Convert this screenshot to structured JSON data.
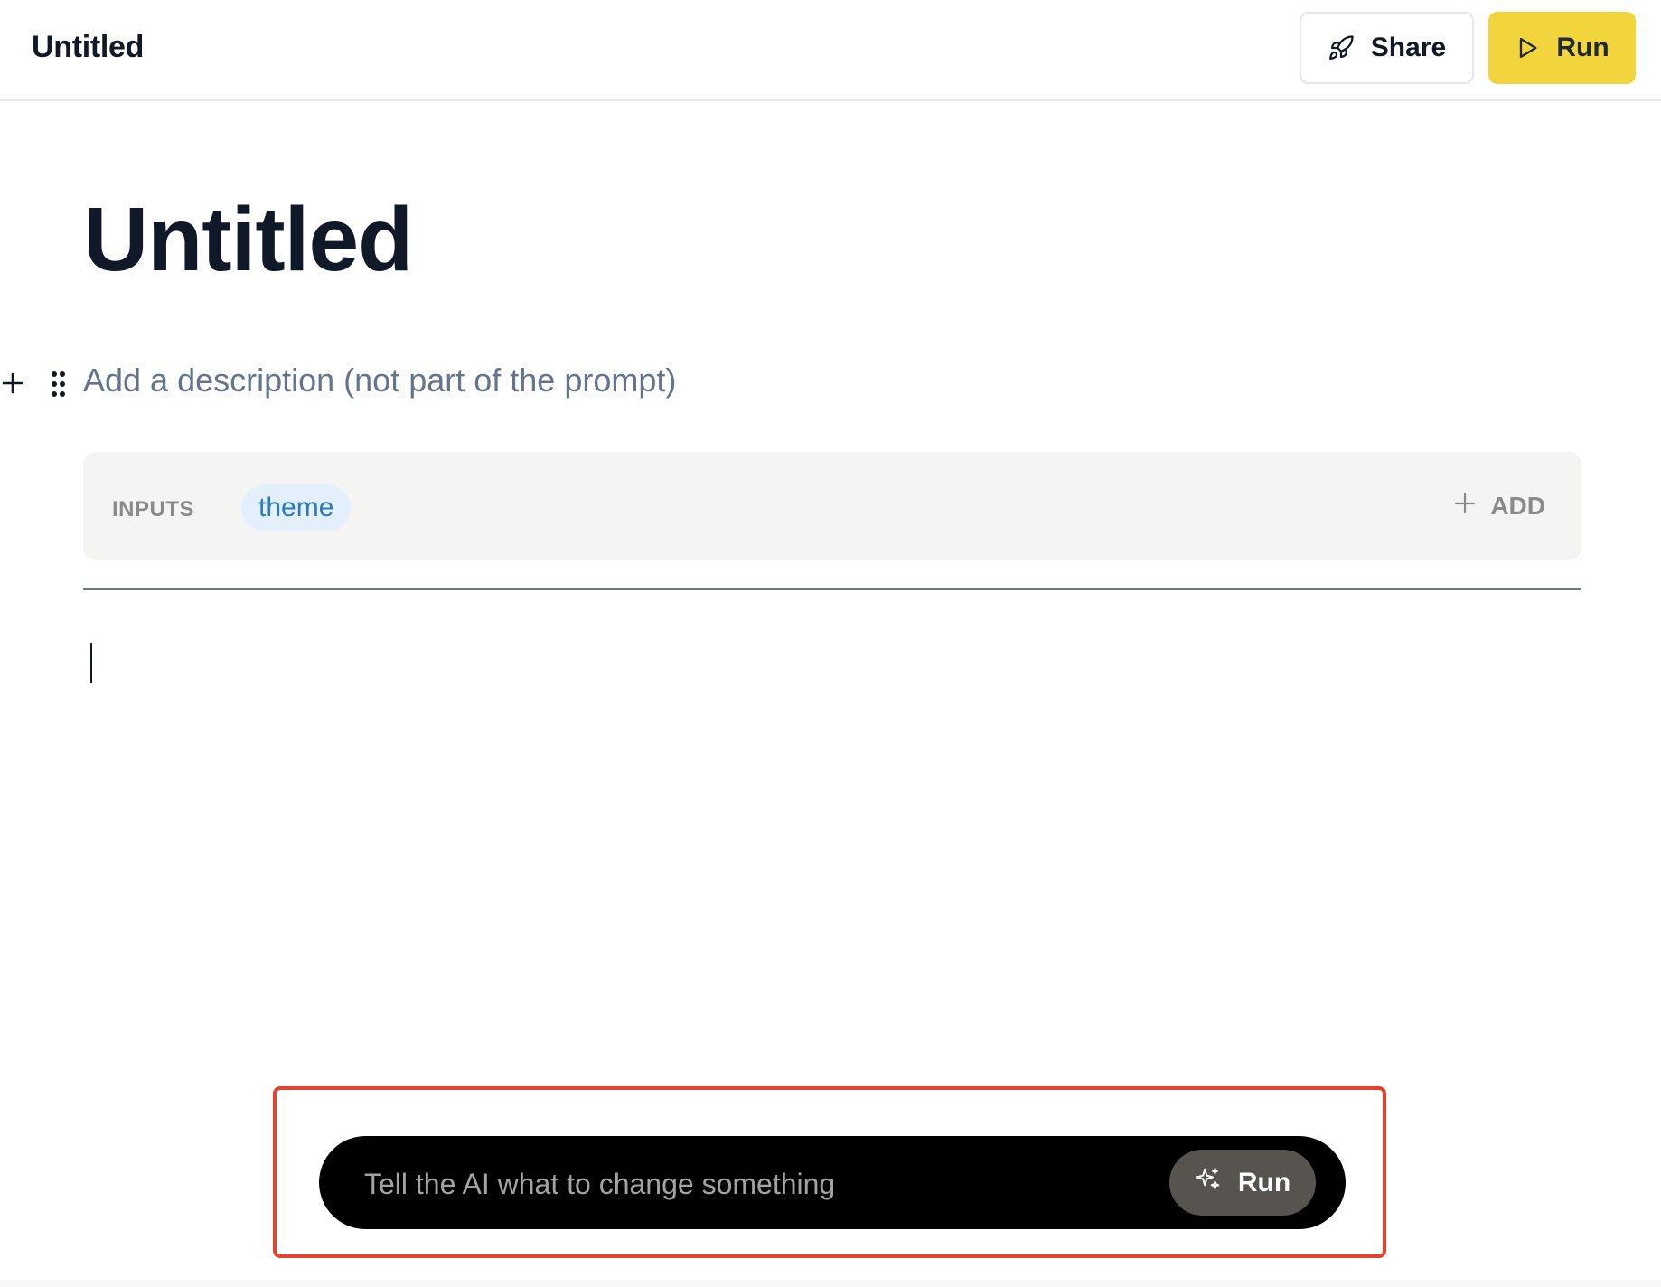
{
  "header": {
    "app_title": "Untitled",
    "share_label": "Share",
    "share_icon": "rocket-icon",
    "run_label": "Run",
    "run_icon": "play-icon"
  },
  "document": {
    "title": "Untitled",
    "description_placeholder": "Add a description (not part of the prompt)"
  },
  "inputs": {
    "label": "INPUTS",
    "chips": [
      "theme"
    ],
    "add_label": "ADD"
  },
  "ai_bar": {
    "placeholder": "Tell the AI what to change something",
    "run_label": "Run",
    "run_icon": "sparkles-icon"
  },
  "colors": {
    "run_button": "#f2d43d",
    "chip_bg": "#e3f0fb",
    "chip_text": "#2b7bc3",
    "highlight_border": "#e4432d",
    "ai_bar_bg": "#000000",
    "ai_run_bg": "#57534e"
  }
}
